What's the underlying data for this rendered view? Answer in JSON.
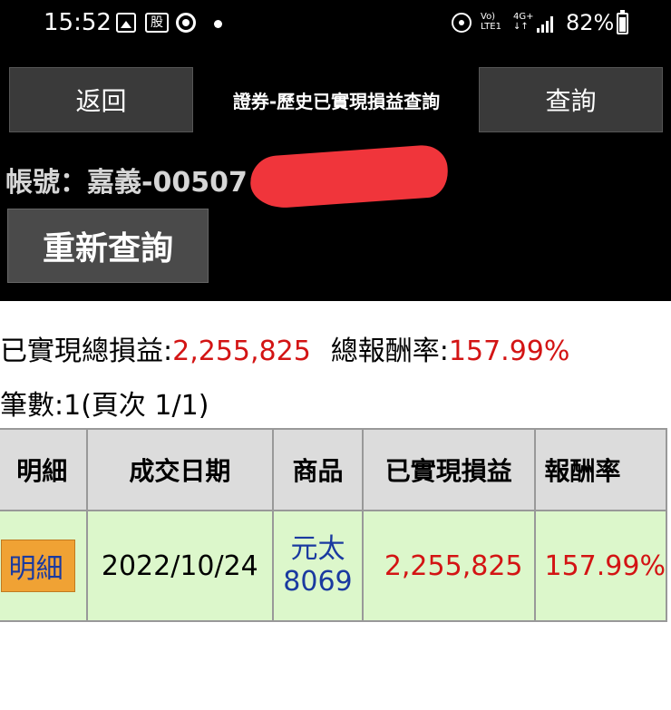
{
  "status_bar": {
    "time": "15:52",
    "stock_icon_label": "股",
    "volte_line1": "Vo)",
    "volte_line2": "LTE1",
    "network_line1": "4G+",
    "network_line2": "↓↑",
    "battery": "82%"
  },
  "header": {
    "back_label": "返回",
    "title": "證券-歷史已實現損益查詢",
    "query_label": "查詢",
    "account_label": "帳號：",
    "account_value": "嘉義-00507",
    "requery_label": "重新查詢"
  },
  "summary": {
    "realized_label": "已實現總損益:",
    "realized_value": "2,255,825",
    "return_label": "總報酬率:",
    "return_value": "157.99%",
    "count_text": "筆數:1(頁次 1/1)"
  },
  "table": {
    "headers": [
      "明細",
      "成交日期",
      "商品",
      "已實現損益",
      "報酬率"
    ],
    "rows": [
      {
        "detail": "明細",
        "date": "2022/10/24",
        "product_name": "元太",
        "product_code": "8069",
        "realized": "2,255,825",
        "return": "157.99%"
      }
    ]
  },
  "colors": {
    "profit_red": "#d31414",
    "link_blue": "#1a3aa0",
    "row_green": "#dcf7cb",
    "detail_orange": "#f0a234"
  }
}
